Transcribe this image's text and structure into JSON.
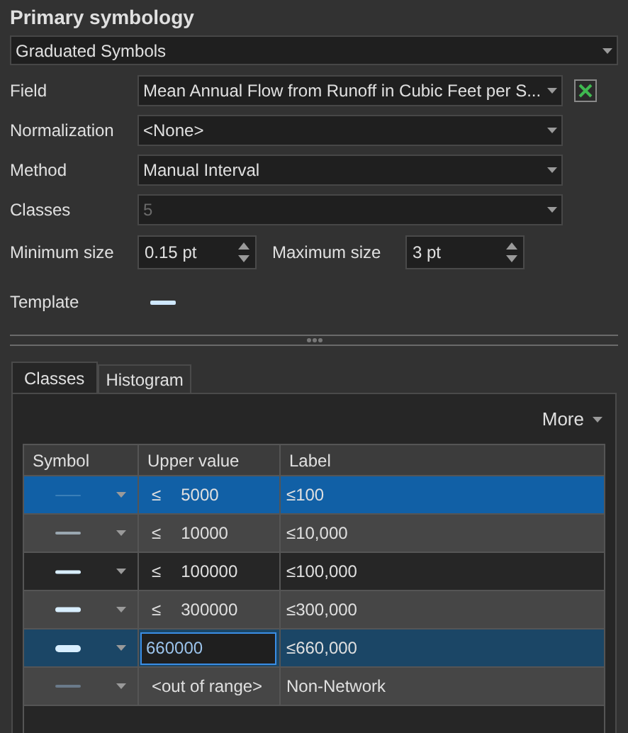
{
  "title": "Primary symbology",
  "renderer": {
    "value": "Graduated Symbols"
  },
  "fields": [
    {
      "label": "Field",
      "value": "Mean Annual Flow from Runoff in Cubic Feet per S...",
      "disabled": false,
      "expression_button": true
    },
    {
      "label": "Normalization",
      "value": "<None>",
      "disabled": false,
      "expression_button": false
    },
    {
      "label": "Method",
      "value": "Manual Interval",
      "disabled": false,
      "expression_button": false
    },
    {
      "label": "Classes",
      "value": "5",
      "disabled": true,
      "expression_button": false
    }
  ],
  "size": [
    {
      "label": "Minimum size",
      "value": "0.15 pt"
    },
    {
      "label": "Maximum size",
      "value": "3 pt"
    }
  ],
  "template": {
    "label": "Template"
  },
  "tabs": [
    {
      "label": "Classes",
      "selected": true
    },
    {
      "label": "Histogram",
      "selected": false
    }
  ],
  "more": "More",
  "table": {
    "columns": [
      "Symbol",
      "Upper value",
      "Label"
    ],
    "rows": [
      {
        "kind": "class",
        "op": "≤",
        "value": "5000",
        "label": "≤100",
        "selected": true,
        "editing": false
      },
      {
        "kind": "class",
        "op": "≤",
        "value": "10000",
        "label": "≤10,000",
        "selected": false,
        "editing": false
      },
      {
        "kind": "class",
        "op": "≤",
        "value": "100000",
        "label": "≤100,000",
        "selected": false,
        "editing": false
      },
      {
        "kind": "class",
        "op": "≤",
        "value": "300000",
        "label": "≤300,000",
        "selected": false,
        "editing": false
      },
      {
        "kind": "class",
        "value": "660000",
        "label": "≤660,000",
        "selected": false,
        "editing": true
      },
      {
        "kind": "out_of_range",
        "value": "<out of range>",
        "label": "Non-Network",
        "selected": false,
        "editing": false
      }
    ]
  }
}
